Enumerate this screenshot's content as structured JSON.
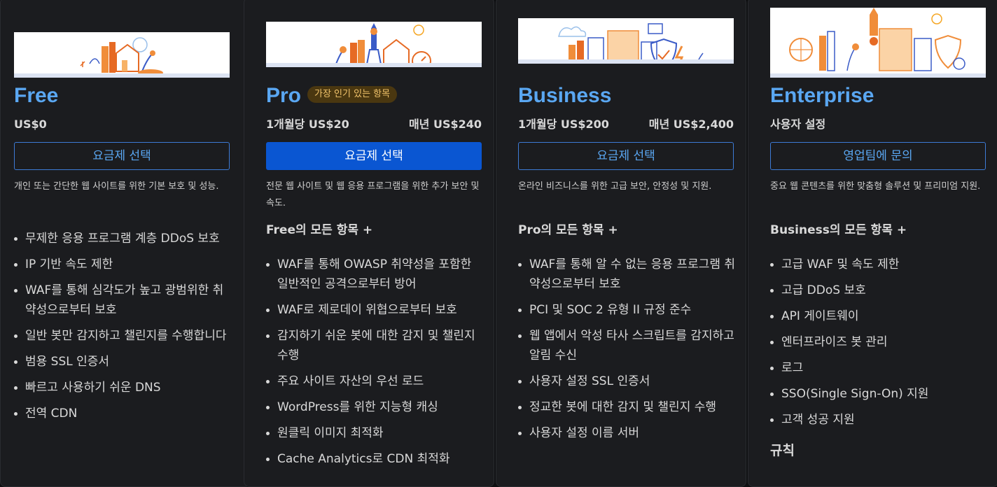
{
  "plans": [
    {
      "name": "Free",
      "price": "US$0",
      "button": "요금제 선택",
      "description": "개인 또는 간단한 웹 사이트를 위한 기본 보호 및 성능.",
      "features": [
        "무제한 응용 프로그램 계층 DDoS 보호",
        "IP 기반 속도 제한",
        "WAF를 통해 심각도가 높고 광범위한 취약성으로부터 보호",
        "일반 봇만 감지하고 챌린지를 수행합니다",
        "범용 SSL 인증서",
        "빠르고 사용하기 쉬운 DNS",
        "전역 CDN"
      ]
    },
    {
      "name": "Pro",
      "badge": "가장 인기 있는 항목",
      "price_monthly": "1개월당 US$20",
      "price_yearly": "매년 US$240",
      "button": "요금제 선택",
      "description": "전문 웹 사이트 및 웹 응용 프로그램을 위한 추가 보안 및 속도.",
      "includes": "Free의 모든 항목 +",
      "features": [
        "WAF를 통해 OWASP 취약성을 포함한 일반적인 공격으로부터 방어",
        "WAF로 제로데이 위협으로부터 보호",
        "감지하기 쉬운 봇에 대한 감지 및 챌린지 수행",
        "주요 사이트 자산의 우선 로드",
        "WordPress를 위한 지능형 캐싱",
        "원클릭 이미지 최적화",
        "Cache Analytics로 CDN 최적화"
      ]
    },
    {
      "name": "Business",
      "price_monthly": "1개월당 US$200",
      "price_yearly": "매년 US$2,400",
      "button": "요금제 선택",
      "description": "온라인 비즈니스를 위한 고급 보안, 안정성 및 지원.",
      "includes": "Pro의 모든 항목 +",
      "features": [
        "WAF를 통해 알 수 없는 응용 프로그램 취약성으로부터 보호",
        "PCI 및 SOC 2 유형 II 규정 준수",
        "웹 앱에서 악성 타사 스크립트를 감지하고 알림 수신",
        "사용자 설정 SSL 인증서",
        "정교한 봇에 대한 감지 및 챌린지 수행",
        "사용자 설정 이름 서버"
      ]
    },
    {
      "name": "Enterprise",
      "price": "사용자 설정",
      "button": "영업팀에 문의",
      "description": "중요 웹 콘텐츠를 위한 맞춤형 솔루션 및 프리미엄 지원.",
      "includes": "Business의 모든 항목 +",
      "features": [
        "고급 WAF 및 속도 제한",
        "고급 DDoS 보호",
        "API 게이트웨이",
        "엔터프라이즈 봇 관리",
        "로그",
        "SSO(Single Sign-On) 지원",
        "고객 성공 지원"
      ],
      "extra_heading": "규칙"
    }
  ],
  "colors": {
    "background": "#0f1012",
    "card": "#1b1c1f",
    "accent": "#5aa7f2",
    "primary_button": "#0a56d2",
    "badge_bg": "#4a3710",
    "badge_text": "#f1c36b"
  }
}
